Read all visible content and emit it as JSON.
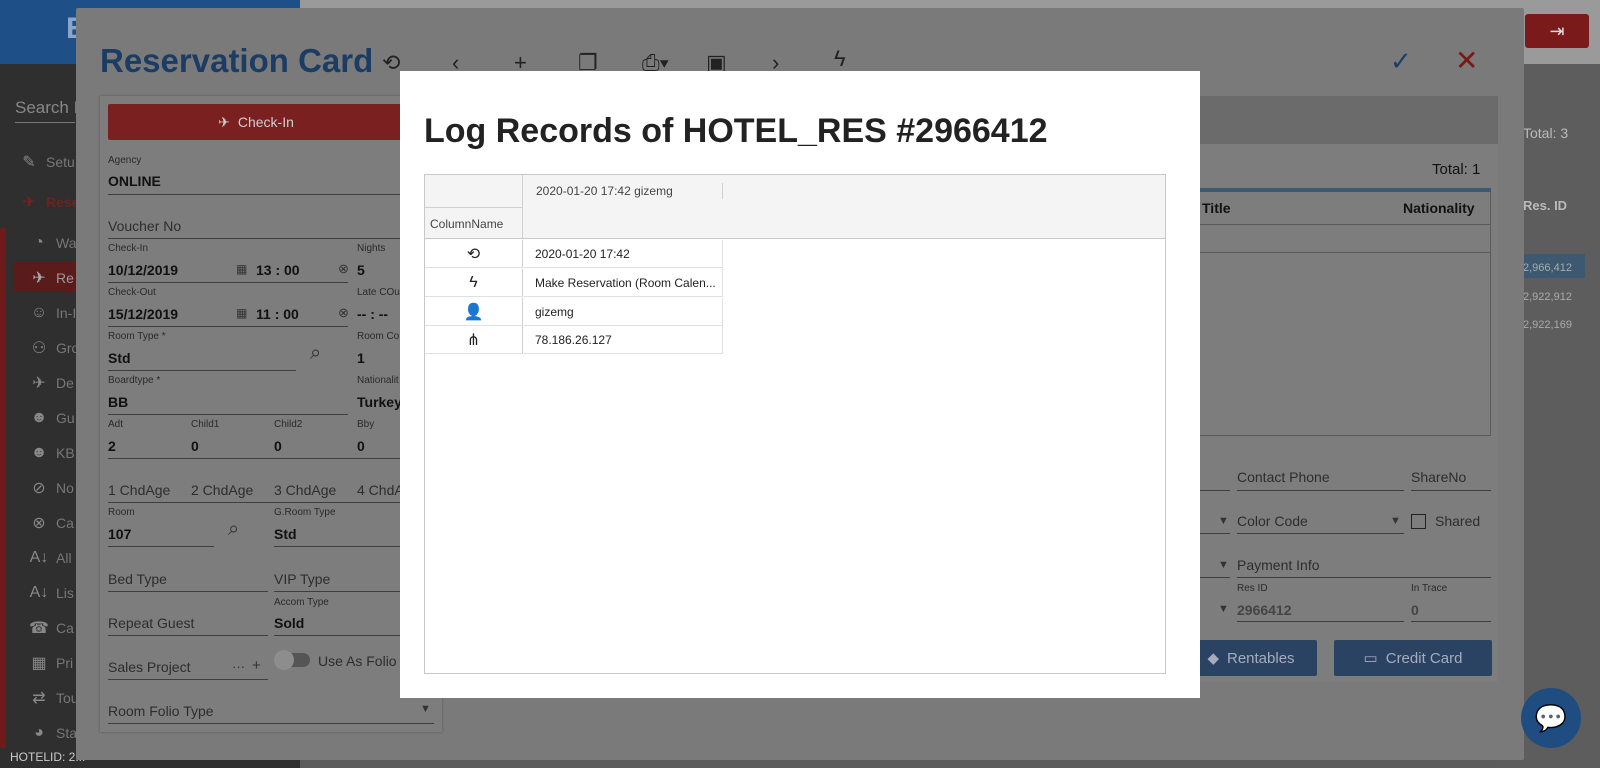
{
  "app": {
    "logo_text": "E",
    "logout_icon": "logout-icon"
  },
  "sidebar": {
    "search_placeholder": "Search I",
    "items": [
      {
        "label": "Setu",
        "icon": "wrench-icon"
      },
      {
        "label": "Rese",
        "icon": "plane-icon"
      },
      {
        "label": "Wa",
        "icon": "clock-icon"
      },
      {
        "label": "Re",
        "icon": "plane-land-icon"
      },
      {
        "label": "In-I",
        "icon": "people-icon"
      },
      {
        "label": "Gro",
        "icon": "group-add-icon"
      },
      {
        "label": "De",
        "icon": "plane-depart-icon"
      },
      {
        "label": "Gu",
        "icon": "guests-icon"
      },
      {
        "label": "KB",
        "icon": "guests-icon"
      },
      {
        "label": "No",
        "icon": "eye-off-icon"
      },
      {
        "label": "Ca",
        "icon": "cancel-icon"
      },
      {
        "label": "All",
        "icon": "sort-az-icon"
      },
      {
        "label": "Lis",
        "icon": "sort-az-icon"
      },
      {
        "label": "Ca",
        "icon": "phone-icon"
      },
      {
        "label": "Pri",
        "icon": "calendar-icon"
      },
      {
        "label": "Tou",
        "icon": "swap-icon"
      },
      {
        "label": "Sta",
        "icon": "pie-icon"
      }
    ],
    "hotel_id": "HOTELID: 2..."
  },
  "right_list": {
    "total": "Total: 3",
    "resid_header": "Res. ID",
    "ids": [
      "2,966,412",
      "2,922,912",
      "2,922,169"
    ]
  },
  "card": {
    "title": "Reservation Card",
    "checkin_label": "Check-In",
    "fields": {
      "agency_label": "Agency",
      "agency": "ONLINE",
      "voucher_ph": "Voucher No",
      "checkin_label": "Check-In",
      "checkin_date": "10/12/2019",
      "checkin_time": "13 : 00",
      "nights_label": "Nights",
      "nights": "5",
      "checkout_label": "Check-Out",
      "checkout_date": "15/12/2019",
      "checkout_time": "11 : 00",
      "latecout_label": "Late COu",
      "latecout": "-- : --",
      "roomtype_label": "Room Type *",
      "roomtype": "Std",
      "roomcount_label": "Room Co",
      "roomcount": "1",
      "boardtype_label": "Boardtype *",
      "boardtype": "BB",
      "nationality_label": "Nationalit",
      "nationality": "Turkey",
      "adt_label": "Adt",
      "adt": "2",
      "child1_label": "Child1",
      "child1": "0",
      "child2_label": "Child2",
      "child2": "0",
      "bby_label": "Bby",
      "bby": "0",
      "chd1": "1 ChdAge",
      "chd2": "2 ChdAge",
      "chd3": "3 ChdAge",
      "chd4": "4 ChdA",
      "room_label": "Room",
      "room": "107",
      "groomtype_label": "G.Room Type",
      "groomtype": "Std",
      "bedtype_ph": "Bed Type",
      "viptype_ph": "VIP Type",
      "repeat_ph": "Repeat Guest",
      "accom_label": "Accom Type",
      "accom": "Sold",
      "sales_ph": "Sales Project",
      "use_as_folio": "Use As Folio",
      "roomfolio_ph": "Room Folio Type"
    },
    "right": {
      "total": "Total: 1",
      "col_title": "Title",
      "col_nationality": "Nationality",
      "contact_phone": "Contact Phone",
      "share_no": "ShareNo",
      "color_code": "Color Code",
      "shared": "Shared",
      "payment_info": "Payment Info",
      "resid_label": "Res ID",
      "resid": "2966412",
      "intrace_label": "In Trace",
      "intrace": "0",
      "rentables": "Rentables",
      "credit_card": "Credit Card"
    }
  },
  "modal": {
    "title": "Log Records of HOTEL_RES #2966412",
    "row_header": "ColumnName",
    "column_header": "2020-01-20 17:42 gizemg",
    "rows": [
      {
        "icon": "history-icon",
        "value": "2020-01-20 17:42"
      },
      {
        "icon": "flash-icon",
        "value": "Make Reservation (Room Calen..."
      },
      {
        "icon": "person-icon",
        "value": "gizemg"
      },
      {
        "icon": "network-icon",
        "value": "78.186.26.127"
      }
    ]
  }
}
